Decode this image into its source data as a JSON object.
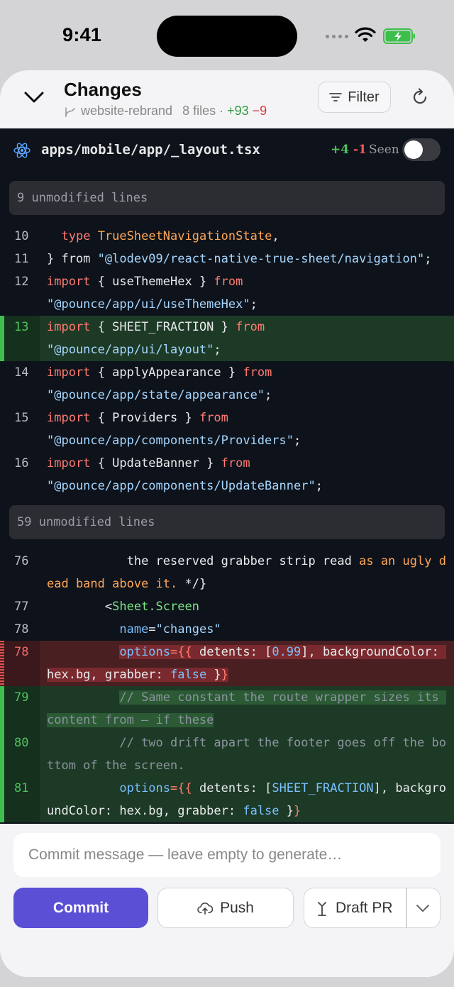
{
  "status": {
    "time": "9:41"
  },
  "header": {
    "title": "Changes",
    "branch": "website-rebrand",
    "files": "8 files",
    "separator": "·",
    "additions": "+93",
    "deletions": "−9",
    "filter_label": "Filter"
  },
  "file": {
    "path": "apps/mobile/app/_layout.tsx",
    "additions": "+4",
    "deletions": "-1",
    "seen_label": "Seen",
    "seen_on": false
  },
  "unmodified": [
    "9 unmodified lines",
    "59 unmodified lines"
  ],
  "line_numbers": [
    "10",
    "11",
    "12",
    "13",
    "14",
    "15",
    "16",
    "76",
    "77",
    "78",
    "78",
    "79",
    "80",
    "81"
  ],
  "code": {
    "l10": [
      "type",
      "TrueSheetNavigationState",
      ","
    ],
    "l11": [
      "} from ",
      "\"@lodev09/react-native-true-sheet/navigation\"",
      ";"
    ],
    "l12": [
      "import",
      " { useThemeHex } ",
      "from",
      "\"@pounce/app/ui/useThemeHex\"",
      ";"
    ],
    "l13": [
      "import",
      " { SHEET_FRACTION } ",
      "from",
      "\"@pounce/app/ui/layout\"",
      ";"
    ],
    "l14": [
      "import",
      " { applyAppearance } ",
      "from",
      "\"@pounce/app/state/appearance\"",
      ";"
    ],
    "l15": [
      "import",
      " { Providers } ",
      "from",
      "\"@pounce/app/components/Providers\"",
      ";"
    ],
    "l16": [
      "import",
      " { UpdateBanner } ",
      "from",
      "\"@pounce/app/components/UpdateBanner\"",
      ";"
    ],
    "l76": [
      "the reserved grabber strip read ",
      "as an ugly dead band above it.",
      " */}"
    ],
    "l77": [
      "<",
      "Sheet.Screen"
    ],
    "l78": [
      "name",
      "=",
      "\"changes\""
    ],
    "l78d": [
      "options",
      "={{",
      " detents: [",
      "0.99",
      "], backgroundColor: hex.bg, grabber: ",
      "false",
      " }",
      "}"
    ],
    "l79": [
      "// Same constant the route wrapper sizes its content from — if these"
    ],
    "l80": [
      "// two drift apart the footer goes off the bottom of the screen."
    ],
    "l81": [
      "options",
      "={{",
      " detents: [",
      "SHEET_FRACTION",
      "], backgroundColor: hex.bg, grabber: ",
      "false",
      " }",
      "}"
    ]
  },
  "commit": {
    "placeholder": "Commit message — leave empty to generate…",
    "commit_label": "Commit",
    "push_label": "Push",
    "draft_pr_label": "Draft PR"
  },
  "colors": {
    "accent": "#5b4fd6",
    "added": "#3fbf4f",
    "deleted": "#e05050",
    "editor_bg": "#0e131b"
  }
}
